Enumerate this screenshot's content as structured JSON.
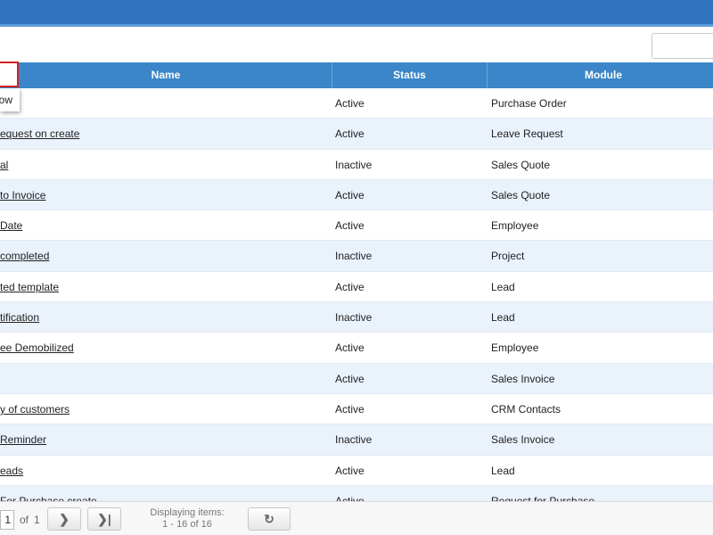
{
  "grid": {
    "columns": {
      "name": "Name",
      "status": "Status",
      "module": "Module"
    },
    "rows": [
      {
        "name": "",
        "status": "Active",
        "module": "Purchase Order"
      },
      {
        "name": "equest on create",
        "status": "Active",
        "module": "Leave Request"
      },
      {
        "name": "al",
        "status": "Inactive",
        "module": "Sales Quote"
      },
      {
        "name": "to Invoice",
        "status": "Active",
        "module": "Sales Quote"
      },
      {
        "name": "Date",
        "status": "Active",
        "module": "Employee"
      },
      {
        "name": "completed",
        "status": "Inactive",
        "module": "Project"
      },
      {
        "name": "ted template",
        "status": "Active",
        "module": "Lead"
      },
      {
        "name": "tification",
        "status": "Inactive",
        "module": "Lead"
      },
      {
        "name": "ee Demobilized",
        "status": "Active",
        "module": "Employee"
      },
      {
        "name": "",
        "status": "Active",
        "module": "Sales Invoice"
      },
      {
        "name": "y of customers",
        "status": "Active",
        "module": "CRM Contacts"
      },
      {
        "name": "Reminder",
        "status": "Inactive",
        "module": "Sales Invoice"
      },
      {
        "name": "eads",
        "status": "Active",
        "module": "Lead"
      },
      {
        "name": "For Purchase create",
        "status": "Active",
        "module": "Request for Purchase"
      }
    ]
  },
  "popup": {
    "text": "low"
  },
  "pager": {
    "page_value": "1",
    "of_label": "of",
    "total_pages": "1",
    "displaying_label": "Displaying items:",
    "displaying_range": "1 - 16 of 16",
    "next_glyph": "❯",
    "last_glyph": "❯|",
    "refresh_glyph": "↻"
  }
}
